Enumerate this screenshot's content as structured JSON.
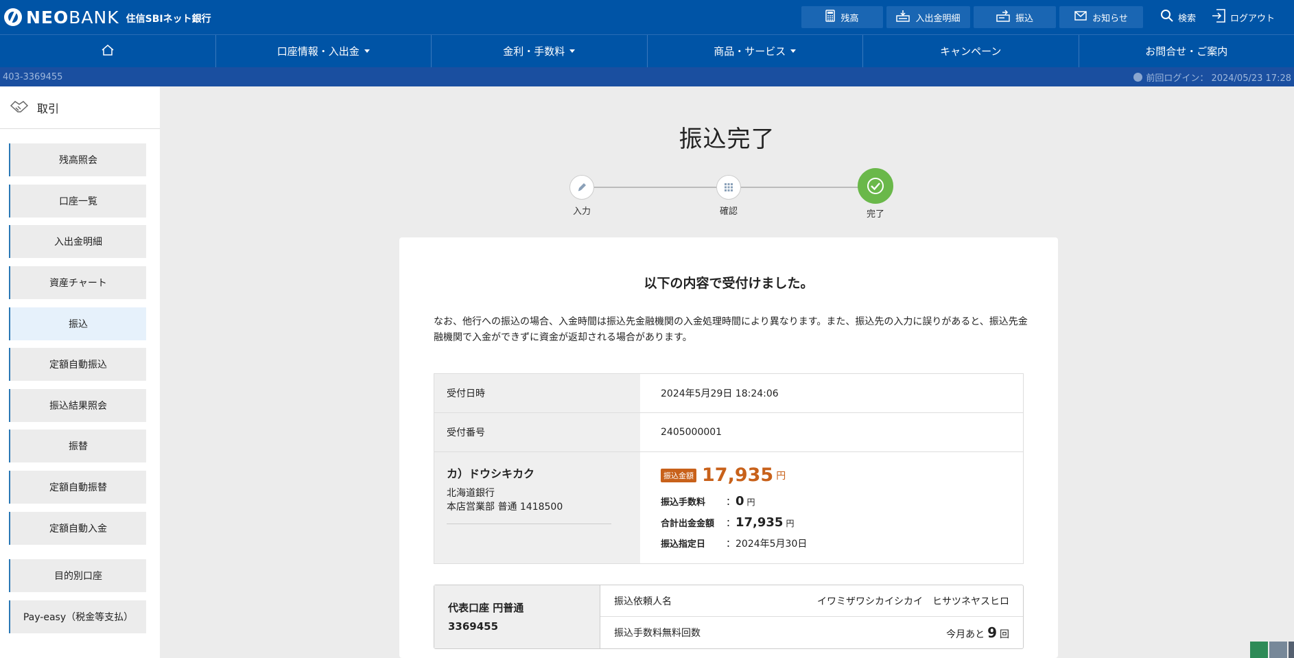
{
  "header": {
    "logo_neo": "NEO",
    "logo_bank": "BANK",
    "logo_sub": "住信SBIネット銀行",
    "buttons": [
      {
        "label": "残高",
        "icon": "calculator-icon"
      },
      {
        "label": "入出金明細",
        "icon": "statement-icon"
      },
      {
        "label": "振込",
        "icon": "transfer-icon"
      },
      {
        "label": "お知らせ",
        "icon": "mail-icon"
      }
    ],
    "search_label": "検索",
    "logout_label": "ログアウト"
  },
  "nav": {
    "items": [
      {
        "label": "",
        "icon": "home-icon"
      },
      {
        "label": "口座情報・入出金",
        "dropdown": true
      },
      {
        "label": "金利・手数料",
        "dropdown": true
      },
      {
        "label": "商品・サービス",
        "dropdown": true
      },
      {
        "label": "キャンペーン",
        "dropdown": false
      },
      {
        "label": "お問合せ・ご案内",
        "dropdown": false
      }
    ]
  },
  "infobar": {
    "account": "403-3369455",
    "last_login": "前回ログイン： 2024/05/23 17:28"
  },
  "sidebar": {
    "heading": "取引",
    "items": [
      {
        "label": "残高照会",
        "active": false
      },
      {
        "label": "口座一覧",
        "active": false
      },
      {
        "label": "入出金明細",
        "active": false
      },
      {
        "label": "資産チャート",
        "active": false
      },
      {
        "label": "振込",
        "active": true
      },
      {
        "label": "定額自動振込",
        "active": false
      },
      {
        "label": "振込結果照会",
        "active": false
      },
      {
        "label": "振替",
        "active": false
      },
      {
        "label": "定額自動振替",
        "active": false
      },
      {
        "label": "定額自動入金",
        "active": false
      },
      {
        "label": "目的別口座",
        "active": false
      },
      {
        "label": "Pay-easy（税金等支払）",
        "active": false
      }
    ]
  },
  "page": {
    "title": "振込完了",
    "steps": [
      {
        "label": "入力",
        "icon": "pencil-icon",
        "state": "done"
      },
      {
        "label": "確認",
        "icon": "keypad-icon",
        "state": "done"
      },
      {
        "label": "完了",
        "icon": "check-icon",
        "state": "current"
      }
    ]
  },
  "result": {
    "heading": "以下の内容で受付けました。",
    "note": "なお、他行への振込の場合、入金時間は振込先金融機関の入金処理時間により異なります。また、振込先の入力に誤りがあると、振込先金融機関で入金ができずに資金が返却される場合があります。",
    "received_at_label": "受付日時",
    "received_at": "2024年5月29日 18:24:06",
    "receipt_no_label": "受付番号",
    "receipt_no": "2405000001",
    "payee": {
      "name": "カ）ドウシキカク",
      "bank": "北海道銀行",
      "branch": "本店営業部 普通 1418500"
    },
    "amount_badge": "振込金額",
    "amount": "17,935",
    "yen": "円",
    "fee_label": "振込手数料",
    "fee": "0",
    "total_label": "合計出金金額",
    "total": "17,935",
    "date_label": "振込指定日",
    "date": "2024年5月30日",
    "colon": "："
  },
  "account": {
    "name": "代表口座 円普通",
    "number": "3369455",
    "requester_label": "振込依頼人名",
    "requester": "イワミザワシカイシカイ　ヒサツネヤスヒロ",
    "free_label": "振込手数料無料回数",
    "free_prefix": "今月あと",
    "free_count": "9",
    "free_suffix": "回"
  },
  "colors": {
    "brand": "#0054a6",
    "accent_orange": "#c8611a",
    "success_green": "#6ab84a"
  }
}
